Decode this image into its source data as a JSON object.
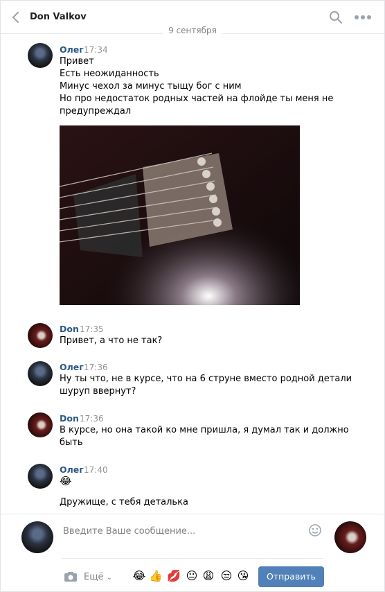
{
  "header": {
    "title": "Don Valkov"
  },
  "date_separator": "9 сентября",
  "messages": [
    {
      "author": "Олег",
      "time": "17:34",
      "lines": [
        "Привет",
        "Есть неожиданность",
        "Минус чехол за минус тыщу бог с ним",
        "Но про недостаток родных частей на флойде ты меня не",
        "предупреждал"
      ]
    },
    {
      "author": "Don",
      "time": "17:35",
      "lines": [
        "Привет, а что не так?"
      ]
    },
    {
      "author": "Олег",
      "time": "17:36",
      "lines": [
        "Ну ты что, не в курсе, что на 6 струне вместо родной детали",
        "шуруп ввернут?"
      ]
    },
    {
      "author": "Don",
      "time": "17:36",
      "lines": [
        "В курсе, но она такой ко мне пришла, я думал так и должно",
        "быть"
      ]
    },
    {
      "author": "Олег",
      "time": "17:40",
      "lines": [
        "😂",
        "Дружище, с тебя деталька"
      ]
    }
  ],
  "composer": {
    "placeholder": "Введите Ваше сообщение...",
    "more_label": "Ещё",
    "send_label": "Отправить",
    "emojis": [
      "😂",
      "👍",
      "💋",
      "😐",
      "😩",
      "😒",
      "😘"
    ]
  },
  "colors": {
    "accent": "#5181b8",
    "author": "#2a5885",
    "muted": "#828282"
  }
}
